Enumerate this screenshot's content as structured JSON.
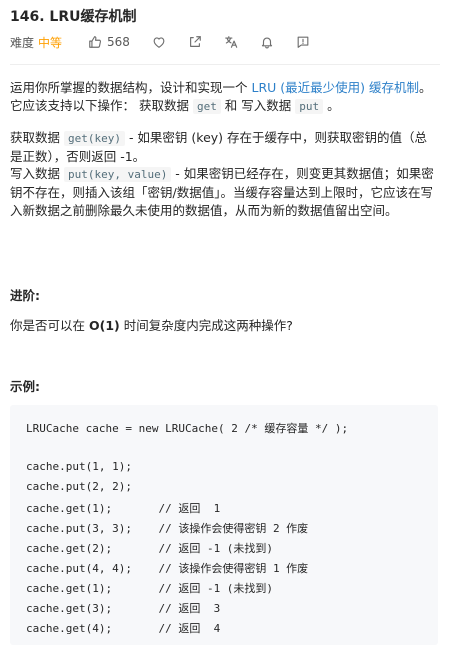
{
  "problem": {
    "title": "146. LRU缓存机制",
    "difficulty_label": "难度",
    "difficulty_value": "中等",
    "likes": "568"
  },
  "icons": [
    "thumbs-up-icon",
    "heart-icon",
    "share-icon",
    "translate-icon",
    "bell-icon",
    "feedback-icon"
  ],
  "description": {
    "intro_1": "运用你所掌握的数据结构，设计和实现一个 ",
    "intro_link": "LRU (最近最少使用) 缓存机制",
    "intro_2": "。它应该支持以下操作： 获取数据 ",
    "code_get": "get",
    "intro_3": " 和 写入数据 ",
    "code_put": "put",
    "intro_4": " 。",
    "get_1": "获取数据 ",
    "get_code": "get(key)",
    "get_2": " - 如果密钥 (key) 存在于缓存中，则获取密钥的值（总是正数），否则返回 -1。",
    "put_1": "写入数据 ",
    "put_code": "put(key, value)",
    "put_2": " - 如果密钥已经存在，则变更其数据值；如果密钥不存在，则插入该组「密钥/数据值」。当缓存容量达到上限时，它应该在写入新数据之前删除最久未使用的数据值，从而为新的数据值留出空间。"
  },
  "followup": {
    "heading": "进阶:",
    "text_1": "你是否可以在 ",
    "text_bold": "O(1)",
    "text_2": " 时间复杂度内完成这两种操作?"
  },
  "example": {
    "heading": "示例:",
    "lines": [
      "LRUCache cache = new LRUCache( 2 /* 缓存容量 */ );",
      "",
      "cache.put(1, 1);",
      "cache.put(2, 2);",
      "cache.get(1);       // 返回  1",
      "cache.put(3, 3);    // 该操作会使得密钥 2 作废",
      "cache.get(2);       // 返回 -1 (未找到)",
      "cache.put(4, 4);    // 该操作会使得密钥 1 作废",
      "cache.get(1);       // 返回 -1 (未找到)",
      "cache.get(3);       // 返回  3",
      "cache.get(4);       // 返回  4"
    ]
  }
}
